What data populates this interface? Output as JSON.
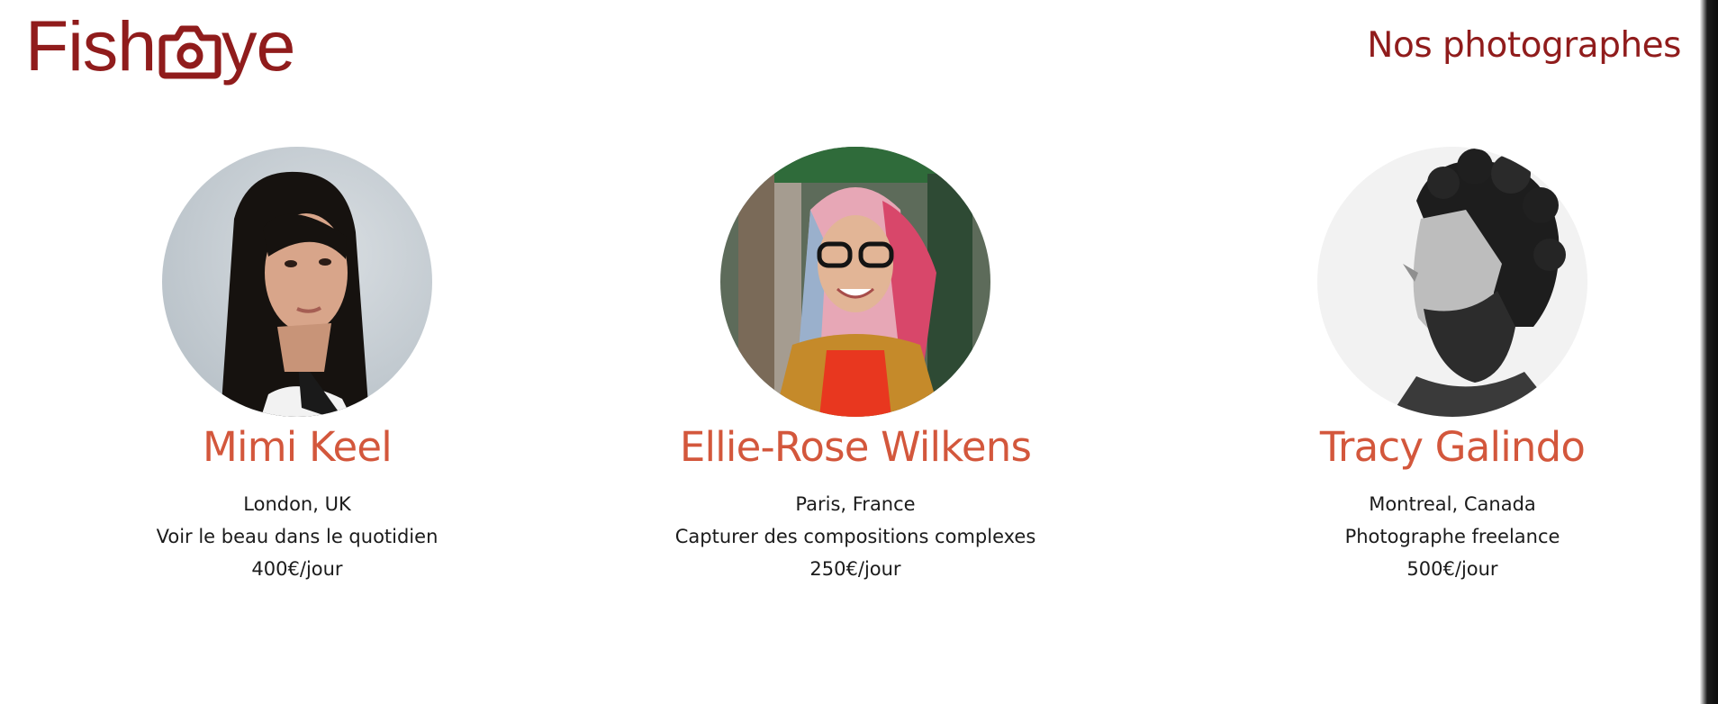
{
  "header": {
    "logo_text": "FishEye",
    "title": "Nos photographes"
  },
  "photographers": [
    {
      "name": "Mimi Keel",
      "location": "London, UK",
      "tagline": "Voir le beau dans le quotidien",
      "price": "400€/jour"
    },
    {
      "name": "Ellie-Rose Wilkens",
      "location": "Paris, France",
      "tagline": "Capturer des compositions complexes",
      "price": "250€/jour"
    },
    {
      "name": "Tracy Galindo",
      "location": "Montreal, Canada",
      "tagline": "Photographe freelance",
      "price": "500€/jour"
    }
  ],
  "colors": {
    "brand": "#901c1c",
    "name_accent": "#d3573c",
    "body_text": "#1b1b1b",
    "background": "#ffffff"
  },
  "icons": {
    "logo_camera": "camera-icon"
  }
}
